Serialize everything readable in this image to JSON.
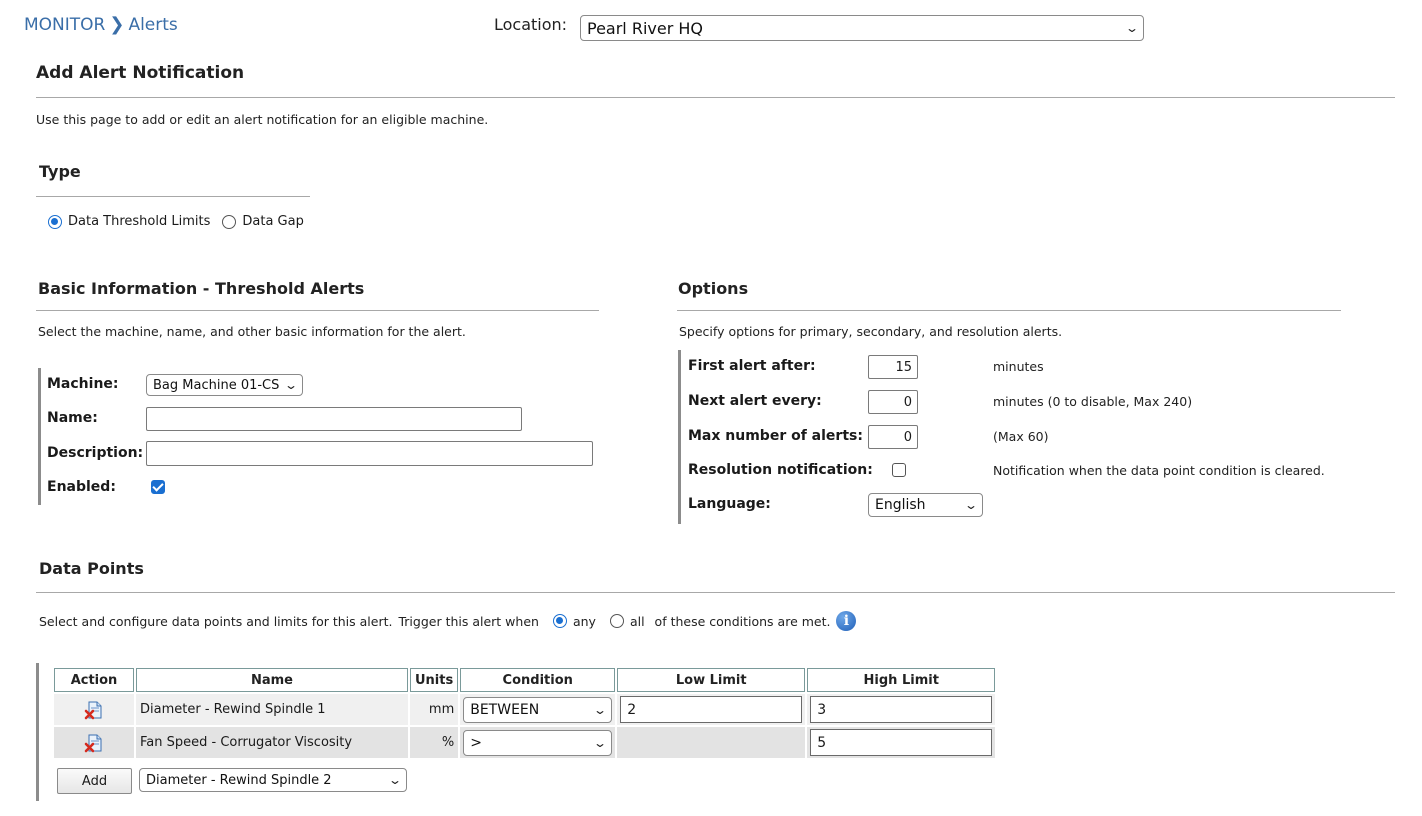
{
  "breadcrumb": {
    "root": "MONITOR",
    "current": "Alerts"
  },
  "location": {
    "label": "Location:",
    "value": "Pearl River HQ"
  },
  "page": {
    "title": "Add Alert Notification",
    "description": "Use this page to add or edit an alert notification for an eligible machine."
  },
  "type_section": {
    "title": "Type",
    "options": [
      {
        "label": "Data Threshold Limits",
        "selected": true
      },
      {
        "label": "Data Gap",
        "selected": false
      }
    ]
  },
  "basic": {
    "title": "Basic Information - Threshold Alerts",
    "description": "Select the machine, name, and other basic information for the alert.",
    "machine_label": "Machine:",
    "machine_value": "Bag Machine 01-CS",
    "name_label": "Name:",
    "name_value": "",
    "description_label": "Description:",
    "description_value": "",
    "enabled_label": "Enabled:",
    "enabled": true
  },
  "options": {
    "title": "Options",
    "description": "Specify options for primary, secondary, and resolution alerts.",
    "first_alert_label": "First alert after:",
    "first_alert_value": "15",
    "first_alert_note": "minutes",
    "next_alert_label": "Next alert every:",
    "next_alert_value": "0",
    "next_alert_note": "minutes (0 to disable, Max 240)",
    "max_alerts_label": "Max number of alerts:",
    "max_alerts_value": "0",
    "max_alerts_note": "(Max 60)",
    "resolution_label": "Resolution notification:",
    "resolution_checked": false,
    "resolution_note": "Notification when the data point condition is cleared.",
    "language_label": "Language:",
    "language_value": "English"
  },
  "data_points": {
    "title": "Data Points",
    "description": "Select and configure data points and limits for this alert.",
    "trigger_prefix": "Trigger this alert when",
    "trigger_any": "any",
    "trigger_all": "all",
    "trigger_selected": "any",
    "trigger_suffix": "of these conditions are met.",
    "columns": [
      "Action",
      "Name",
      "Units",
      "Condition",
      "Low Limit",
      "High Limit"
    ],
    "rows": [
      {
        "name": "Diameter - Rewind Spindle 1",
        "units": "mm",
        "condition": "BETWEEN",
        "low": "2",
        "high": "3"
      },
      {
        "name": "Fan Speed - Corrugator Viscosity",
        "units": "%",
        "condition": ">",
        "low": null,
        "high": "5"
      }
    ],
    "add_label": "Add",
    "add_select_value": "Diameter - Rewind Spindle 2"
  },
  "icons": {
    "delete": "delete-document-icon",
    "info": "info-icon",
    "caret": "chevron-down-icon"
  }
}
